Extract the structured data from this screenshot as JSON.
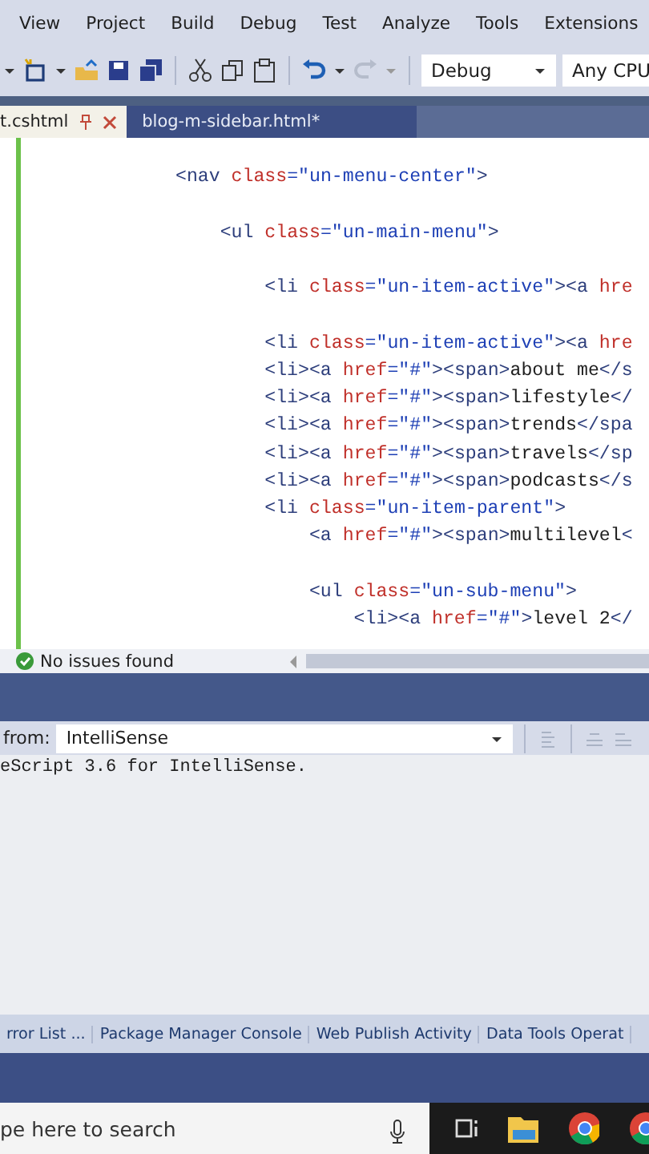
{
  "menu": [
    "View",
    "Project",
    "Build",
    "Debug",
    "Test",
    "Analyze",
    "Tools",
    "Extensions"
  ],
  "toolbar": {
    "configuration": "Debug",
    "platform": "Any CPU"
  },
  "tabs": [
    {
      "label": "t.cshtml",
      "selected": true
    },
    {
      "label": "blog-m-sidebar.html*",
      "selected": false
    }
  ],
  "code_lines": [
    {
      "kind": "code",
      "tokens": [
        {
          "kind": "tag",
          "text": "            <nav "
        },
        {
          "kind": "attr",
          "text": "class"
        },
        {
          "kind": "value",
          "text": "=\"un-menu-center\""
        },
        {
          "kind": "tag",
          "text": ">"
        }
      ]
    },
    {
      "kind": "blank"
    },
    {
      "kind": "code",
      "tokens": [
        {
          "kind": "tag",
          "text": "                <ul "
        },
        {
          "kind": "attr",
          "text": "class"
        },
        {
          "kind": "value",
          "text": "=\"un-main-menu\""
        },
        {
          "kind": "tag",
          "text": ">"
        }
      ]
    },
    {
      "kind": "blank"
    },
    {
      "kind": "code",
      "tokens": [
        {
          "kind": "tag",
          "text": "                    <li "
        },
        {
          "kind": "attr",
          "text": "class"
        },
        {
          "kind": "value",
          "text": "=\"un-item-active\""
        },
        {
          "kind": "tag",
          "text": "><a "
        },
        {
          "kind": "attr",
          "text": "hre"
        }
      ]
    },
    {
      "kind": "blank"
    },
    {
      "kind": "code",
      "tokens": [
        {
          "kind": "tag",
          "text": "                    <li "
        },
        {
          "kind": "attr",
          "text": "class"
        },
        {
          "kind": "value",
          "text": "=\"un-item-active\""
        },
        {
          "kind": "tag",
          "text": "><a "
        },
        {
          "kind": "attr",
          "text": "hre"
        }
      ]
    },
    {
      "kind": "code",
      "tokens": [
        {
          "kind": "tag",
          "text": "                    <li><a "
        },
        {
          "kind": "attr",
          "text": "href"
        },
        {
          "kind": "value",
          "text": "=\"#\""
        },
        {
          "kind": "tag",
          "text": "><span>"
        },
        {
          "kind": "text",
          "text": "about me"
        },
        {
          "kind": "tag",
          "text": "</s"
        }
      ]
    },
    {
      "kind": "code",
      "tokens": [
        {
          "kind": "tag",
          "text": "                    <li><a "
        },
        {
          "kind": "attr",
          "text": "href"
        },
        {
          "kind": "value",
          "text": "=\"#\""
        },
        {
          "kind": "tag",
          "text": "><span>"
        },
        {
          "kind": "text",
          "text": "lifestyle"
        },
        {
          "kind": "tag",
          "text": "</"
        }
      ]
    },
    {
      "kind": "code",
      "tokens": [
        {
          "kind": "tag",
          "text": "                    <li><a "
        },
        {
          "kind": "attr",
          "text": "href"
        },
        {
          "kind": "value",
          "text": "=\"#\""
        },
        {
          "kind": "tag",
          "text": "><span>"
        },
        {
          "kind": "text",
          "text": "trends"
        },
        {
          "kind": "tag",
          "text": "</spa"
        }
      ]
    },
    {
      "kind": "code",
      "tokens": [
        {
          "kind": "tag",
          "text": "                    <li><a "
        },
        {
          "kind": "attr",
          "text": "href"
        },
        {
          "kind": "value",
          "text": "=\"#\""
        },
        {
          "kind": "tag",
          "text": "><span>"
        },
        {
          "kind": "text",
          "text": "travels"
        },
        {
          "kind": "tag",
          "text": "</sp"
        }
      ]
    },
    {
      "kind": "code",
      "tokens": [
        {
          "kind": "tag",
          "text": "                    <li><a "
        },
        {
          "kind": "attr",
          "text": "href"
        },
        {
          "kind": "value",
          "text": "=\"#\""
        },
        {
          "kind": "tag",
          "text": "><span>"
        },
        {
          "kind": "text",
          "text": "podcasts"
        },
        {
          "kind": "tag",
          "text": "</s"
        }
      ]
    },
    {
      "kind": "code",
      "tokens": [
        {
          "kind": "tag",
          "text": "                    <li "
        },
        {
          "kind": "attr",
          "text": "class"
        },
        {
          "kind": "value",
          "text": "=\"un-item-parent\""
        },
        {
          "kind": "tag",
          "text": ">"
        }
      ]
    },
    {
      "kind": "code",
      "tokens": [
        {
          "kind": "tag",
          "text": "                        <a "
        },
        {
          "kind": "attr",
          "text": "href"
        },
        {
          "kind": "value",
          "text": "=\"#\""
        },
        {
          "kind": "tag",
          "text": "><span>"
        },
        {
          "kind": "text",
          "text": "multilevel"
        },
        {
          "kind": "tag",
          "text": "<"
        }
      ]
    },
    {
      "kind": "blank"
    },
    {
      "kind": "code",
      "tokens": [
        {
          "kind": "tag",
          "text": "                        <ul "
        },
        {
          "kind": "attr",
          "text": "class"
        },
        {
          "kind": "value",
          "text": "=\"un-sub-menu\""
        },
        {
          "kind": "tag",
          "text": ">"
        }
      ]
    },
    {
      "kind": "code",
      "tokens": [
        {
          "kind": "tag",
          "text": "                            <li><a "
        },
        {
          "kind": "attr",
          "text": "href"
        },
        {
          "kind": "value",
          "text": "=\"#\""
        },
        {
          "kind": "tag",
          "text": ">"
        },
        {
          "kind": "text",
          "text": "level 2"
        },
        {
          "kind": "tag",
          "text": "</"
        }
      ]
    }
  ],
  "status": "No issues found",
  "output": {
    "label": "from:",
    "source": "IntelliSense",
    "text": "eScript 3.6 for IntelliSense."
  },
  "panel_tabs": [
    "rror List ...",
    "Package Manager Console",
    "Web Publish Activity",
    "Data Tools Operat"
  ],
  "taskbar": {
    "placeholder": "pe here to search"
  }
}
